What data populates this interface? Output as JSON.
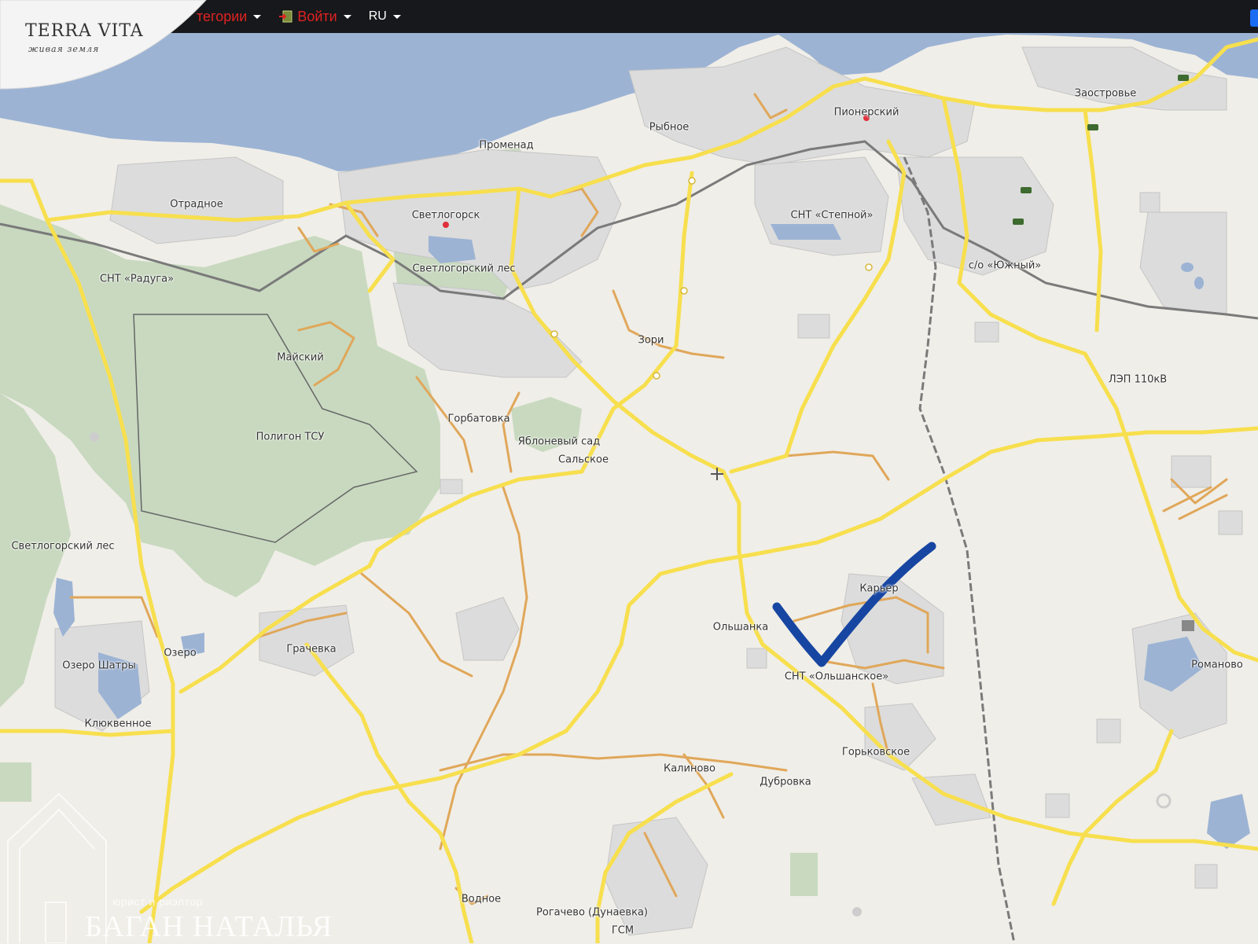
{
  "app": {
    "logo_title": "TERRA VITA",
    "logo_subtitle": "живая земля"
  },
  "nav": {
    "categories_label": "тегории",
    "login_label": "Войти",
    "language_label": "RU",
    "accent_color": "#e02222"
  },
  "map": {
    "labels": [
      {
        "id": "otradnoe",
        "text": "Отрадное"
      },
      {
        "id": "promenad",
        "text": "Променад"
      },
      {
        "id": "rybnoe",
        "text": "Рыбное"
      },
      {
        "id": "pionersky",
        "text": "Пионерский"
      },
      {
        "id": "zaostrovye",
        "text": "Заостровье"
      },
      {
        "id": "svetlogorsk",
        "text": "Светлогорск"
      },
      {
        "id": "svetlogorsky-les-top",
        "text": "Светлогорский лес"
      },
      {
        "id": "snt-raduga",
        "text": "СНТ «Радуга»"
      },
      {
        "id": "snt-stepnoy",
        "text": "СНТ «Степной»"
      },
      {
        "id": "so-yuzhny",
        "text": "с/о «Южный»"
      },
      {
        "id": "maysky",
        "text": "Майский"
      },
      {
        "id": "zori",
        "text": "Зори"
      },
      {
        "id": "lep",
        "text": "ЛЭП 110кВ"
      },
      {
        "id": "gorbatovka",
        "text": "Горбатовка"
      },
      {
        "id": "poligon",
        "text": "Полигон ТСУ"
      },
      {
        "id": "yablonevy-sad",
        "text": "Яблоневый сад"
      },
      {
        "id": "salskoe",
        "text": "Сальское"
      },
      {
        "id": "svetlogorsky-les-left",
        "text": "Светлогорский лес"
      },
      {
        "id": "karyer",
        "text": "Карьер"
      },
      {
        "id": "olshanka",
        "text": "Ольшанка"
      },
      {
        "id": "ozero-shatry",
        "text": "Озеро Шатры"
      },
      {
        "id": "ozero",
        "text": "Озеро"
      },
      {
        "id": "grachevka",
        "text": "Грачевка"
      },
      {
        "id": "snt-olshanskoe",
        "text": "СНТ «Ольшанское»"
      },
      {
        "id": "romanovo",
        "text": "Романово"
      },
      {
        "id": "klyukvennoe",
        "text": "Клюквенное"
      },
      {
        "id": "gorkovskoe",
        "text": "Горьковское"
      },
      {
        "id": "kalinovo",
        "text": "Калиново"
      },
      {
        "id": "dubrovka",
        "text": "Дубровка"
      },
      {
        "id": "vodnoe",
        "text": "Водное"
      },
      {
        "id": "rogachevo",
        "text": "Рогачево (Дунаевка)"
      },
      {
        "id": "gsm",
        "text": "ГСМ"
      }
    ],
    "colors": {
      "land": "#f0eee8",
      "water": "#9cb3d4",
      "forest": "#c8d9bf",
      "built": "#dcdcdc",
      "major_road": "#f7df4e",
      "minor_road": "#e0a75a",
      "railway": "#7a7a7a",
      "checkmark": "#1746a2"
    }
  },
  "watermark": {
    "subtitle": "юрист и риэлтор",
    "name": "БАГАН НАТАЛЬЯ"
  }
}
